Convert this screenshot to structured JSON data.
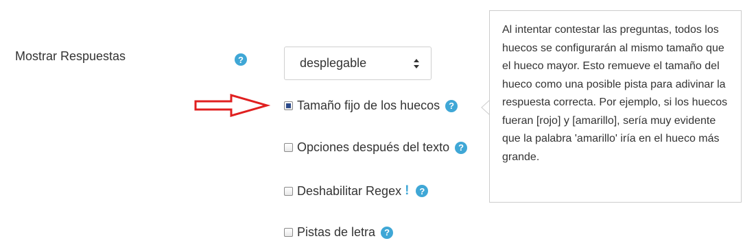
{
  "form": {
    "label": "Mostrar Respuestas",
    "select": {
      "value": "desplegable"
    }
  },
  "options": [
    {
      "label": "Tamaño fijo de los huecos",
      "checked": true
    },
    {
      "label": "Opciones después del texto",
      "checked": false
    },
    {
      "label": "Deshabilitar Regex",
      "checked": false,
      "warning": "!"
    },
    {
      "label": "Pistas de letra",
      "checked": false
    }
  ],
  "help_glyph": "?",
  "tooltip": {
    "text": "Al intentar contestar las preguntas, todos los huecos se configurarán al mismo tamaño que el hueco mayor. Esto remueve el tamaño del hueco como una posible pista para adivinar la respuesta correcta. Por ejemplo, si los huecos fueran [rojo] y [amarillo], sería muy evidente que la palabra 'amarillo' iría en el hueco más grande."
  },
  "colors": {
    "help_icon": "#3fa7d6",
    "annotation_arrow": "#e02020"
  }
}
